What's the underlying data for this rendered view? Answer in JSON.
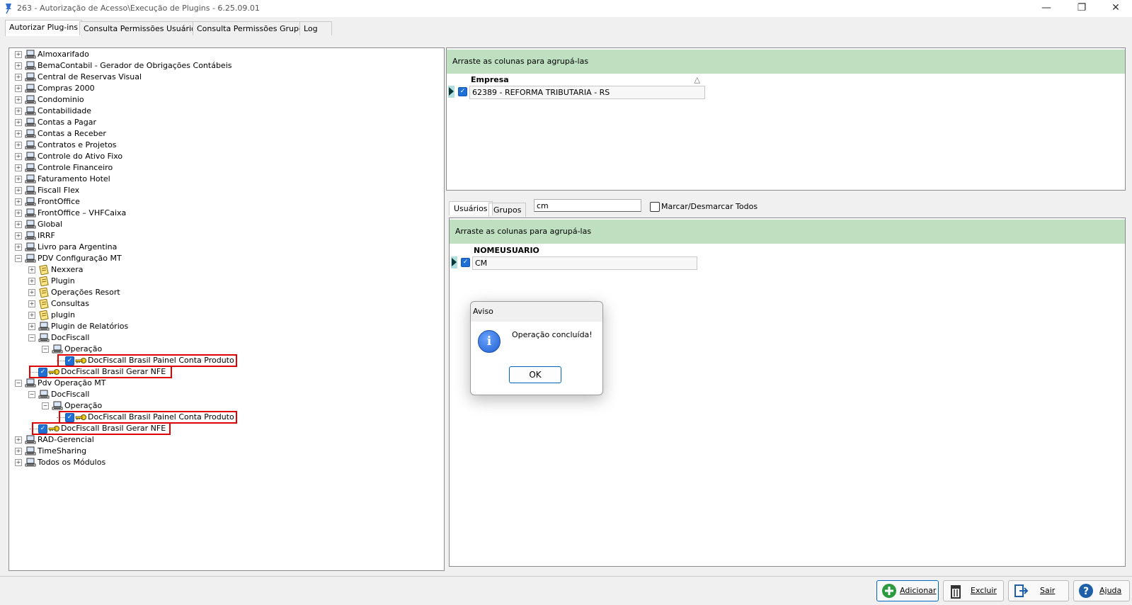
{
  "window": {
    "title": "263 - Autorização de Acesso\\Execução de Plugins - 6.25.09.01",
    "controls": [
      "—",
      "❐",
      "✕"
    ]
  },
  "tabs": [
    "Autorizar Plug-ins",
    "Consulta Permissões Usuário",
    "Consulta Permissões Grupo",
    "Log"
  ],
  "tree": {
    "top_nodes": [
      "Almoxarifado",
      "BemaContabil - Gerador de Obrigações Contábeis",
      "Central de Reservas Visual",
      "Compras 2000",
      "Condominio",
      "Contabilidade",
      "Contas a Pagar",
      "Contas a Receber",
      "Contratos e Projetos",
      "Controle do Ativo Fixo",
      "Controle Financeiro",
      "Faturamento Hotel",
      "Fiscall Flex",
      "FrontOffice",
      "FrontOffice – VHFCaixa",
      "Global",
      "IRRF",
      "Livro para Argentina"
    ],
    "pdv_config": "PDV Configuração MT",
    "pdv_config_children": [
      "Nexxera",
      "Plugin",
      "Operações Resort",
      "Consultas",
      "plugin",
      "Plugin de Relatórios",
      "DocFiscall"
    ],
    "operacao": "Operação",
    "painel": "DocFiscall Brasil Painel Conta Produto",
    "gerar": "DocFiscall Brasil Gerar NFE",
    "pdv_operacao": "Pdv Operação MT",
    "docfiscall": "DocFiscall",
    "bottom_nodes": [
      "RAD-Gerencial",
      "TimeSharing",
      "Todos os Módulos"
    ]
  },
  "top_grid": {
    "group_hint": "Arraste as colunas para agrupá-las",
    "column": "Empresa",
    "sort_glyph": "△",
    "row": "62389 - REFORMA TRIBUTARIA - RS"
  },
  "sub_tabs": [
    "Usuários",
    "Grupos"
  ],
  "filter": {
    "value": "cm"
  },
  "select_all_label": "Marcar/Desmarcar Todos",
  "bottom_grid": {
    "group_hint": "Arraste as colunas para agrupá-las",
    "column": "NOMEUSUARIO",
    "row": "CM"
  },
  "dialog": {
    "title": "Aviso",
    "message": "Operação concluída!",
    "ok": "OK",
    "info_glyph": "i"
  },
  "actions": {
    "add": "Adicionar",
    "delete": "Excluir",
    "exit": "Sair",
    "help": "Ajuda"
  },
  "colors": {
    "group_header": "#bfe0c0",
    "highlight_border": "#e00000",
    "checkbox": "#1e6fd6"
  }
}
